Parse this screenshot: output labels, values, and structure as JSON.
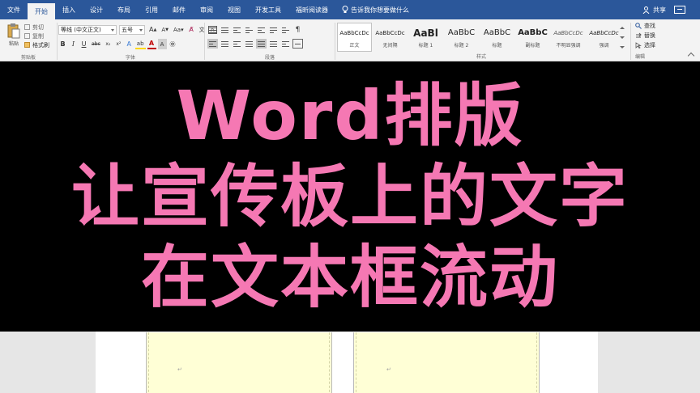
{
  "tabs": [
    {
      "label": "文件",
      "active": false
    },
    {
      "label": "开始",
      "active": true
    },
    {
      "label": "插入",
      "active": false
    },
    {
      "label": "设计",
      "active": false
    },
    {
      "label": "布局",
      "active": false
    },
    {
      "label": "引用",
      "active": false
    },
    {
      "label": "邮件",
      "active": false
    },
    {
      "label": "审阅",
      "active": false
    },
    {
      "label": "视图",
      "active": false
    },
    {
      "label": "开发工具",
      "active": false
    },
    {
      "label": "福昕阅读器",
      "active": false
    }
  ],
  "tell_me": "告诉我你想要做什么",
  "share": "共享",
  "clipboard": {
    "paste": "粘贴",
    "cut": "剪切",
    "copy": "复制",
    "format_painter": "格式刷",
    "group": "剪贴板"
  },
  "font": {
    "name": "等线 (中文正文)",
    "size": "五号",
    "group": "字体"
  },
  "paragraph": {
    "group": "段落"
  },
  "styles": {
    "items": [
      {
        "preview": "AaBbCcDc",
        "name": "正文",
        "active": true
      },
      {
        "preview": "AaBbCcDc",
        "name": "无间隔",
        "active": false
      },
      {
        "preview": "AaBl",
        "name": "标题 1",
        "active": false
      },
      {
        "preview": "AaBbC",
        "name": "标题 2",
        "active": false
      },
      {
        "preview": "AaBbC",
        "name": "标题",
        "active": false
      },
      {
        "preview": "AaBbC",
        "name": "副标题",
        "active": false
      },
      {
        "preview": "AaBbCcDc",
        "name": "不明显强调",
        "active": false
      },
      {
        "preview": "AaBbCcDc",
        "name": "强调",
        "active": false
      }
    ],
    "group": "样式"
  },
  "editing": {
    "find": "查找",
    "replace": "替换",
    "select": "选择",
    "group": "编辑"
  },
  "banner": {
    "line1": "Word排版",
    "line2": "让宣传板上的文字",
    "line3": "在文本框流动",
    "color": "#f578b3"
  },
  "paragraph_mark": "↵",
  "colors": {
    "titlebar": "#2b579a",
    "ribbon": "#f3f3f3",
    "textbox": "#ffffd6",
    "banner_bg": "#000000"
  }
}
